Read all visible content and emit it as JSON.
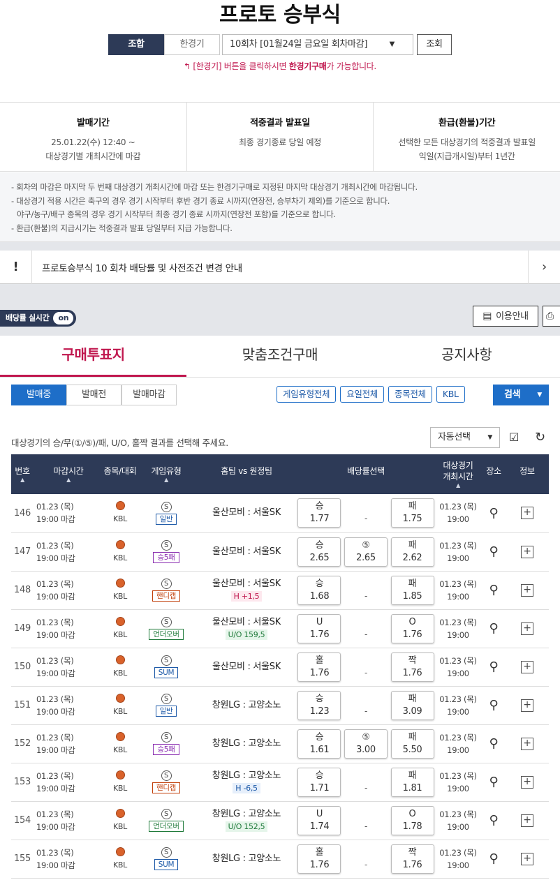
{
  "title": "프로토 승부식",
  "mode_tabs": [
    "조합",
    "한경기"
  ],
  "round_select": "10회차 [01월24일 금요일 회차마감]",
  "query_button": "조회",
  "hint": {
    "prefix": "[한경기] 버튼을 클릭하시면 ",
    "bold": "한경기구매",
    "suffix": "가 가능합니다."
  },
  "info": [
    {
      "title": "발매기간",
      "line1": "25.01.22(수) 12:40 ~",
      "line2": "대상경기별 개최시간에 마감"
    },
    {
      "title": "적중결과 발표일",
      "line1": "최종 경기종료 당일 예정",
      "line2": ""
    },
    {
      "title": "환급(환불)기간",
      "line1": "선택한 모든 대상경기의 적중결과 발표일",
      "line2": "익일(지급개시일)부터 1년간"
    }
  ],
  "notes": [
    "- 회차의 마감은 마지막 두 번째 대상경기 개최시간에 마감 또는 한경기구매로 지정된 마지막 대상경기 개최시간에 마감됩니다.",
    "- 대상경기 적용 시간은 축구의 경우 경기 시작부터 후반 경기 종료 시까지(연장전, 승부차기 제외)를 기준으로 합니다.",
    "  야구/농구/배구 종목의 경우 경기 시작부터 최종 경기 종료 시까지(연장전 포함)를 기준으로 합니다.",
    "- 환급(환불)의 지급시기는 적중결과 발표 당일부터 지급 가능합니다."
  ],
  "notice": "프로토승부식 10 회차 배당률 및 사전조건 변경 안내",
  "toggle": {
    "label": "배당률 실시간",
    "state": "on"
  },
  "guide_button": "이용안내",
  "main_tabs": [
    "구매투표지",
    "맞춤조건구매",
    "공지사항"
  ],
  "sale_tabs": [
    "발매중",
    "발매전",
    "발매마감"
  ],
  "filters": [
    "게임유형전체",
    "요일전체",
    "종목전체",
    "KBL"
  ],
  "search_button": "검색",
  "instruction": "대상경기의 승/무(①/⑤)/패, U/O, 홀짝 결과를 선택해 주세요.",
  "auto_select": "자동선택",
  "headers": {
    "no": "번호",
    "deadline": "마감시간",
    "sport": "종목/대회",
    "gametype": "게임유형",
    "match": "홈팀 vs 원정팀",
    "odds": "배당률선택",
    "gamedate_1": "대상경기",
    "gamedate_2": "개최시간",
    "loc": "장소",
    "info": "정보"
  },
  "rows": [
    {
      "no": "146",
      "date": "01.23 (목)",
      "dtime": "19:00 마감",
      "league": "KBL",
      "s": "S",
      "type": "일반",
      "tc": "",
      "teams": "울산모비 : 서울SK",
      "cond": "",
      "cc": "",
      "o1l": "승",
      "o1": "1.77",
      "o2l": "",
      "o2": "-",
      "o3l": "패",
      "o3": "1.75",
      "gd": "01.23 (목)",
      "gt": "19:00"
    },
    {
      "no": "147",
      "date": "01.23 (목)",
      "dtime": "19:00 마감",
      "league": "KBL",
      "s": "S",
      "type": "승5패",
      "tc": "p",
      "teams": "울산모비 : 서울SK",
      "cond": "",
      "cc": "",
      "o1l": "승",
      "o1": "2.65",
      "o2l": "⑤",
      "o2": "2.65",
      "o3l": "패",
      "o3": "2.62",
      "gd": "01.23 (목)",
      "gt": "19:00"
    },
    {
      "no": "148",
      "date": "01.23 (목)",
      "dtime": "19:00 마감",
      "league": "KBL",
      "s": "S",
      "type": "핸디캡",
      "tc": "o",
      "teams": "울산모비 : 서울SK",
      "cond": "H +1,5",
      "cc": "r",
      "o1l": "승",
      "o1": "1.68",
      "o2l": "",
      "o2": "-",
      "o3l": "패",
      "o3": "1.85",
      "gd": "01.23 (목)",
      "gt": "19:00"
    },
    {
      "no": "149",
      "date": "01.23 (목)",
      "dtime": "19:00 마감",
      "league": "KBL",
      "s": "S",
      "type": "언더오버",
      "tc": "g",
      "teams": "울산모비 : 서울SK",
      "cond": "U/O 159,5",
      "cc": "g",
      "o1l": "U",
      "o1": "1.76",
      "o2l": "",
      "o2": "-",
      "o3l": "O",
      "o3": "1.76",
      "gd": "01.23 (목)",
      "gt": "19:00"
    },
    {
      "no": "150",
      "date": "01.23 (목)",
      "dtime": "19:00 마감",
      "league": "KBL",
      "s": "S",
      "type": "SUM",
      "tc": "",
      "teams": "울산모비 : 서울SK",
      "cond": "",
      "cc": "",
      "o1l": "홀",
      "o1": "1.76",
      "o2l": "",
      "o2": "-",
      "o3l": "짝",
      "o3": "1.76",
      "gd": "01.23 (목)",
      "gt": "19:00"
    },
    {
      "no": "151",
      "date": "01.23 (목)",
      "dtime": "19:00 마감",
      "league": "KBL",
      "s": "S",
      "type": "일반",
      "tc": "",
      "teams": "창원LG : 고양소노",
      "cond": "",
      "cc": "",
      "o1l": "승",
      "o1": "1.23",
      "o2l": "",
      "o2": "-",
      "o3l": "패",
      "o3": "3.09",
      "gd": "01.23 (목)",
      "gt": "19:00"
    },
    {
      "no": "152",
      "date": "01.23 (목)",
      "dtime": "19:00 마감",
      "league": "KBL",
      "s": "S",
      "type": "승5패",
      "tc": "p",
      "teams": "창원LG : 고양소노",
      "cond": "",
      "cc": "",
      "o1l": "승",
      "o1": "1.61",
      "o2l": "⑤",
      "o2": "3.00",
      "o3l": "패",
      "o3": "5.50",
      "gd": "01.23 (목)",
      "gt": "19:00"
    },
    {
      "no": "153",
      "date": "01.23 (목)",
      "dtime": "19:00 마감",
      "league": "KBL",
      "s": "S",
      "type": "핸디캡",
      "tc": "o",
      "teams": "창원LG : 고양소노",
      "cond": "H -6,5",
      "cc": "b",
      "o1l": "승",
      "o1": "1.71",
      "o2l": "",
      "o2": "-",
      "o3l": "패",
      "o3": "1.81",
      "gd": "01.23 (목)",
      "gt": "19:00"
    },
    {
      "no": "154",
      "date": "01.23 (목)",
      "dtime": "19:00 마감",
      "league": "KBL",
      "s": "S",
      "type": "언더오버",
      "tc": "g",
      "teams": "창원LG : 고양소노",
      "cond": "U/O 152,5",
      "cc": "g",
      "o1l": "U",
      "o1": "1.74",
      "o2l": "",
      "o2": "-",
      "o3l": "O",
      "o3": "1.78",
      "gd": "01.23 (목)",
      "gt": "19:00"
    },
    {
      "no": "155",
      "date": "01.23 (목)",
      "dtime": "19:00 마감",
      "league": "KBL",
      "s": "S",
      "type": "SUM",
      "tc": "",
      "teams": "창원LG : 고양소노",
      "cond": "",
      "cc": "",
      "o1l": "홀",
      "o1": "1.76",
      "o2l": "",
      "o2": "-",
      "o3l": "짝",
      "o3": "1.76",
      "gd": "01.23 (목)",
      "gt": "19:00"
    }
  ],
  "colors": {
    "navy": "#2d3a57",
    "accent": "#c0174e",
    "blue": "#1e6ec8"
  },
  "icons": {
    "notice": "exclamation-icon",
    "chevron": "chevron-right-icon",
    "guide": "book-icon",
    "print": "printer-icon",
    "location": "map-pin-icon",
    "plus": "plus-icon",
    "sport": "basketball-icon",
    "refresh": "refresh-icon"
  }
}
